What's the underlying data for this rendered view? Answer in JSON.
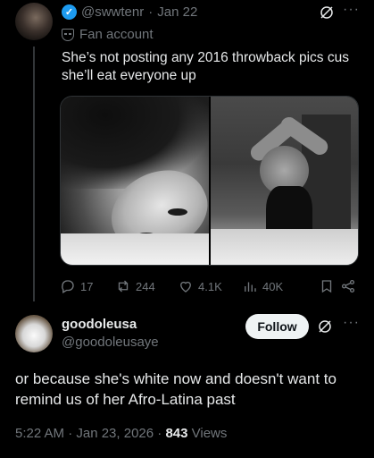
{
  "tweet": {
    "handle": "@swwtenr",
    "separator": "·",
    "date": "Jan 22",
    "label": "Fan account",
    "text": "She’s not posting any 2016 throwback pics cus she’ll eat everyone up",
    "images": [
      "photo-1",
      "photo-2"
    ],
    "actions": {
      "replies": "17",
      "reposts": "244",
      "likes": "4.1K",
      "views": "40K"
    }
  },
  "reply": {
    "name": "goodoleusa",
    "handle": "@goodoleusaye",
    "follow_label": "Follow",
    "text": "or because she's white now and doesn't want to remind us of her Afro-Latina past",
    "timestamp": "5:22 AM · Jan 23, 2026 · ",
    "views_count": "843",
    "views_label": " Views"
  },
  "icons": {
    "verified": "verified-badge-icon",
    "grok": "grok-icon",
    "more": "more-icon",
    "fan": "mask-icon",
    "reply": "reply-icon",
    "repost": "repost-icon",
    "like": "heart-icon",
    "analytics": "analytics-icon",
    "bookmark": "bookmark-icon",
    "share": "share-icon"
  },
  "colors": {
    "background": "#000000",
    "text": "#e7e9ea",
    "muted": "#71767b",
    "accent": "#1d9bf0",
    "follow_bg": "#eff3f4"
  }
}
